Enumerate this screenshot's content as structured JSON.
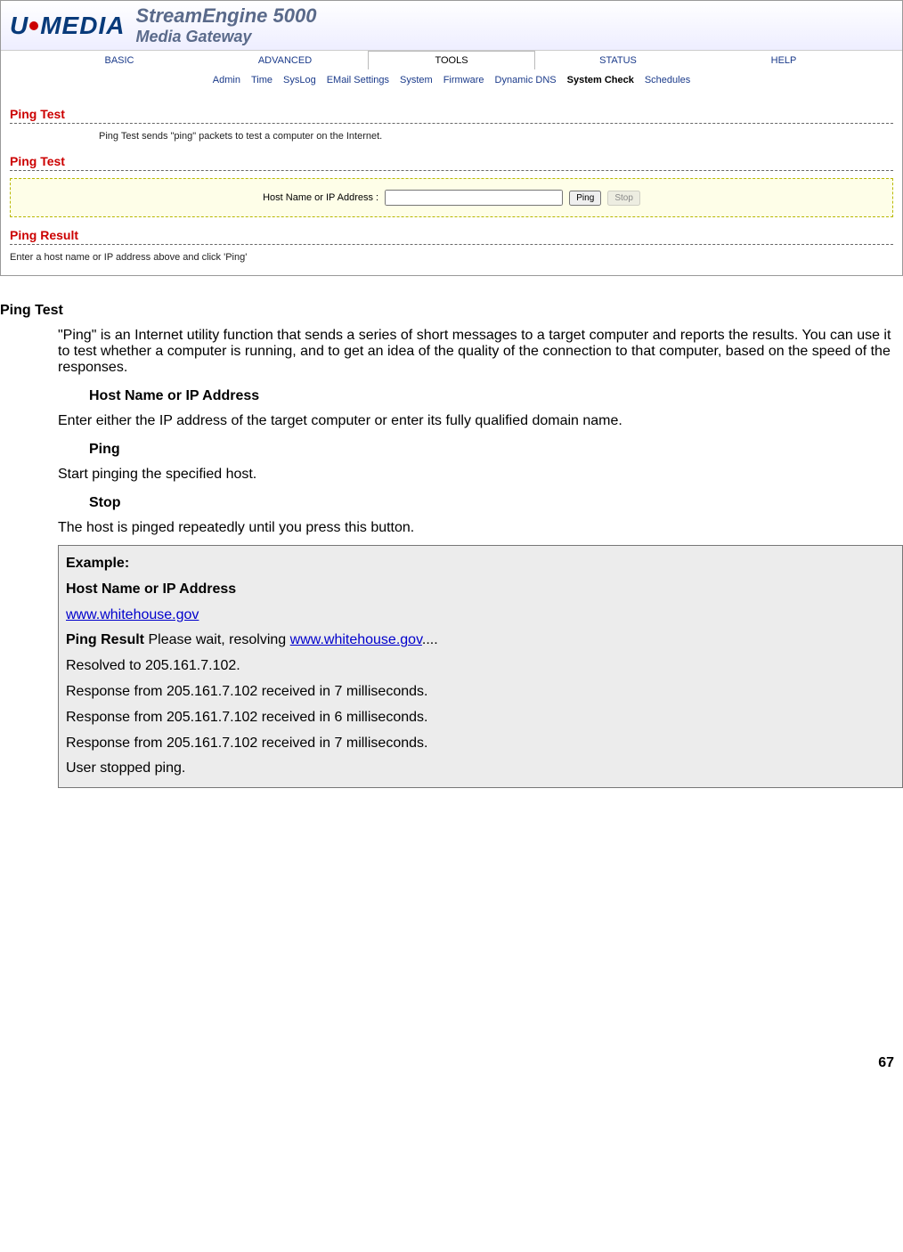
{
  "header": {
    "logo_u": "U",
    "logo_media": "MEDIA",
    "product_title": "StreamEngine 5000",
    "product_subtitle": "Media Gateway"
  },
  "maintabs": {
    "basic": "BASIC",
    "advanced": "ADVANCED",
    "tools": "TOOLS",
    "status": "STATUS",
    "help": "HELP"
  },
  "subtabs": {
    "admin": "Admin",
    "time": "Time",
    "syslog": "SysLog",
    "email": "EMail Settings",
    "system": "System",
    "firmware": "Firmware",
    "ddns": "Dynamic DNS",
    "system_check": "System Check",
    "schedules": "Schedules"
  },
  "panel": {
    "title": "Ping Test",
    "description": "Ping Test sends \"ping\" packets to test a computer on the Internet.",
    "form_title": "Ping Test",
    "host_label": "Host Name or IP Address :",
    "host_value": "",
    "btn_ping": "Ping",
    "btn_stop": "Stop",
    "result_title": "Ping Result",
    "result_desc": "Enter a host name or IP address above and click 'Ping'"
  },
  "doc": {
    "heading": "Ping Test",
    "intro": "\"Ping\" is an Internet utility function that sends a series of short messages to a target computer and reports the results. You can use it to test whether a computer is running, and to get an idea of the quality of the connection to that computer, based on the speed of the responses.",
    "host_label": "Host Name or IP Address",
    "host_desc": "Enter either the IP address of the target computer or enter its fully qualified domain name.",
    "ping_label": "Ping",
    "ping_desc": "Start pinging the specified host.",
    "stop_label": "Stop",
    "stop_desc": "The host is pinged repeatedly until you press this button.",
    "example": {
      "title": "Example:",
      "host_label": "Host Name or IP Address",
      "host_value": "www.whitehouse.gov",
      "result_label": "Ping Result",
      "wait_prefix": " Please wait, resolving ",
      "wait_suffix": "....",
      "resolved": "Resolved to 205.161.7.102.",
      "r1": "Response from 205.161.7.102 received in 7 milliseconds.",
      "r2": "Response from 205.161.7.102 received in 6 milliseconds.",
      "r3": "Response from 205.161.7.102 received in 7 milliseconds.",
      "stopped": "User stopped ping."
    }
  },
  "page_number": "67"
}
